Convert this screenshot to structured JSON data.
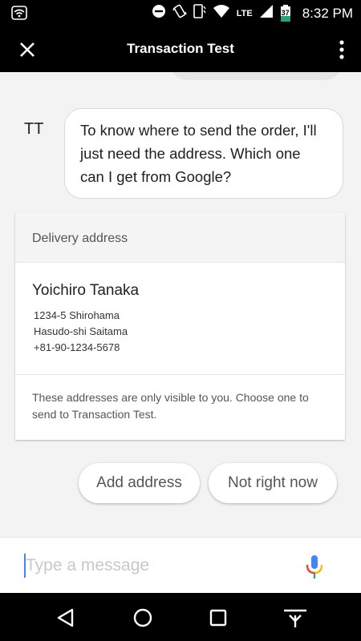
{
  "status_bar": {
    "time": "8:32 PM",
    "network": "LTE",
    "battery_level": "37"
  },
  "app_bar": {
    "title": "Transaction Test"
  },
  "conversation": {
    "bot_avatar": "TT",
    "bot_message": "To know where to send the order, I'll just need the address. Which one can I get from Google?"
  },
  "delivery_card": {
    "header": "Delivery address",
    "name": "Yoichiro Tanaka",
    "address_lines": [
      "1234-5 Shirohama",
      "Hasudo-shi Saitama",
      "+81-90-1234-5678"
    ],
    "footer": "These addresses are only visible to you. Choose one to send to Transaction Test."
  },
  "suggestions": {
    "add_address": "Add address",
    "not_right_now": "Not right now"
  },
  "input": {
    "placeholder": "Type a message"
  },
  "icons": {
    "close": "close-icon",
    "overflow": "more-vert-icon",
    "mic": "mic-icon",
    "nav_back": "back-triangle-icon",
    "nav_home": "home-circle-icon",
    "nav_recents": "recents-square-icon",
    "nav_hide_keyboard": "keyboard-hide-icon"
  },
  "colors": {
    "bar_background": "#000000",
    "cursor_accent": "#4285f4",
    "mic_blue": "#4285f4",
    "mic_red": "#ea4335",
    "mic_yellow": "#fbbc05",
    "mic_green": "#34a853"
  }
}
